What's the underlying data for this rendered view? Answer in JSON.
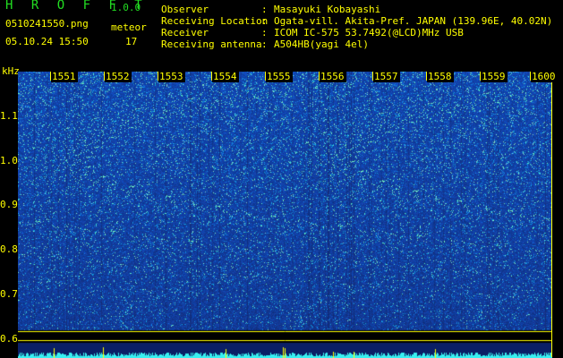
{
  "header": {
    "app_title": "H R O F F T",
    "app_version": "1.0.0",
    "filename": "0510241550.png",
    "datetime": "05.10.24 15:50",
    "meteor_label": "meteor",
    "meteor_count": "17"
  },
  "info": [
    {
      "key": "Observer",
      "sep": ":",
      "value": "Masayuki Kobayashi"
    },
    {
      "key": "Receiving Location",
      "sep": ":",
      "value": "Ogata-vill. Akita-Pref. JAPAN (139.96E, 40.02N)"
    },
    {
      "key": "Receiver",
      "sep": ":",
      "value": "ICOM IC-575 53.7492(@LCD)MHz USB"
    },
    {
      "key": "Receiving antenna",
      "sep": ":",
      "value": "A504HB(yagi 4el)"
    }
  ],
  "axis": {
    "unit": "kHz",
    "y_ticks": [
      "1.1",
      "1.0",
      "0.9",
      "0.8",
      "0.7",
      "0.6"
    ],
    "time_ticks": [
      "1551",
      "1552",
      "1553",
      "1554",
      "1555",
      "1556",
      "1557",
      "1558",
      "1559",
      "1600"
    ]
  },
  "colors": {
    "header_green": "#22dd22",
    "label_yellow": "#ffff00",
    "spectrogram_deep": "#1a3db0",
    "spectrogram_speckle": "#4ad6d0",
    "baseline": "#38f0f0"
  }
}
